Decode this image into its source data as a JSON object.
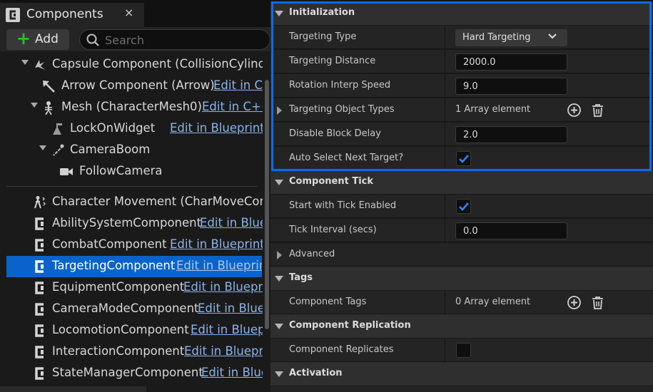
{
  "components_panel": {
    "tab_title": "Components",
    "close_glyph": "×",
    "add_label": "Add",
    "add_glyph": "+",
    "search_placeholder": "Search",
    "tree": [
      {
        "name": "Capsule Component (CollisionCylinder)",
        "icon": "capsule-icon"
      },
      {
        "name": "Arrow Component (Arrow)",
        "link": "Edit in C++",
        "icon": "arrow-component-icon"
      },
      {
        "name": "Mesh (CharacterMesh0)",
        "link": "Edit in C++",
        "icon": "skeleton-mesh-icon"
      },
      {
        "name": "LockOnWidget",
        "link": "Edit in Blueprint",
        "icon": "widget-icon"
      },
      {
        "name": "CameraBoom",
        "icon": "spring-arm-icon"
      },
      {
        "name": "FollowCamera",
        "icon": "camera-icon"
      },
      {
        "name": "Character Movement (CharMoveComp)",
        "icon": "character-movement-icon"
      },
      {
        "name": "AbilitySystemComponent",
        "link": "Edit in Blueprint",
        "icon": "cpp-component-icon"
      },
      {
        "name": "CombatComponent",
        "link": "Edit in Blueprint",
        "icon": "cpp-component-icon"
      },
      {
        "name": "TargetingComponent",
        "link": "Edit in Blueprint",
        "icon": "cpp-component-icon",
        "selected": true
      },
      {
        "name": "EquipmentComponent",
        "link": "Edit in Blueprint",
        "icon": "cpp-component-icon"
      },
      {
        "name": "CameraModeComponent",
        "link": "Edit in Blueprint",
        "icon": "cpp-component-icon"
      },
      {
        "name": "LocomotionComponent",
        "link": "Edit in Blueprint",
        "icon": "cpp-component-icon"
      },
      {
        "name": "InteractionComponent",
        "link": "Edit in Blueprint",
        "icon": "cpp-component-icon"
      },
      {
        "name": "StateManagerComponent",
        "link": "Edit in Blueprint",
        "icon": "cpp-component-icon"
      }
    ]
  },
  "details": {
    "initialization": {
      "title": "Initialization",
      "targeting_type_label": "Targeting Type",
      "targeting_type_value": "Hard Targeting",
      "targeting_distance_label": "Targeting Distance",
      "targeting_distance_value": "2000.0",
      "rotation_interp_label": "Rotation Interp Speed",
      "rotation_interp_value": "9.0",
      "object_types_label": "Targeting Object Types",
      "object_types_value": "1 Array element",
      "disable_block_label": "Disable Block Delay",
      "disable_block_value": "2.0",
      "auto_select_label": "Auto Select Next Target?",
      "auto_select_checked": true
    },
    "component_tick": {
      "title": "Component Tick",
      "start_tick_label": "Start with Tick Enabled",
      "start_tick_checked": true,
      "tick_interval_label": "Tick Interval (secs)",
      "tick_interval_value": "0.0",
      "advanced_label": "Advanced"
    },
    "tags": {
      "title": "Tags",
      "component_tags_label": "Component Tags",
      "component_tags_value": "0 Array element"
    },
    "replication": {
      "title": "Component Replication",
      "replicates_label": "Component Replicates",
      "replicates_checked": false
    },
    "activation": {
      "title": "Activation"
    }
  },
  "colors": {
    "selection": "#0a63ca",
    "highlight_border": "#0a6cf0",
    "add_plus": "#27c12b",
    "link": "#8ab4e8"
  }
}
